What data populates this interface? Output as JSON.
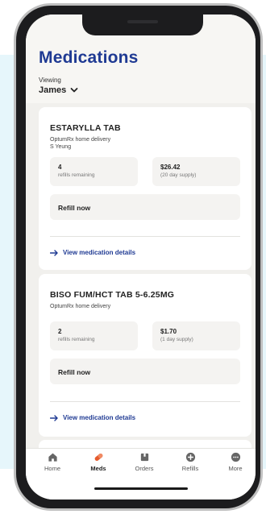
{
  "header": {
    "title": "Medications",
    "viewing_label": "Viewing",
    "viewing_value": "James"
  },
  "medications": [
    {
      "name": "ESTARYLLA TAB",
      "source": "OptumRx home delivery",
      "prescriber": "S Yeung",
      "refills_value": "4",
      "refills_label": "refills remaining",
      "price_value": "$26.42",
      "price_label": "(20 day supply)",
      "refill_button": "Refill now",
      "details_link": "View medication details"
    },
    {
      "name": "BISO FUM/HCT TAB 5-6.25MG",
      "source": "OptumRx home delivery",
      "refills_value": "2",
      "refills_label": "refills remaining",
      "price_value": "$1.70",
      "price_label": "(1 day supply)",
      "refill_button": "Refill now",
      "details_link": "View medication details"
    }
  ],
  "tabs": [
    {
      "label": "Home",
      "icon": "home-icon"
    },
    {
      "label": "Meds",
      "icon": "pill-icon",
      "active": true
    },
    {
      "label": "Orders",
      "icon": "package-icon"
    },
    {
      "label": "Refills",
      "icon": "plus-circle-icon"
    },
    {
      "label": "More",
      "icon": "more-icon"
    }
  ],
  "colors": {
    "brand": "#1f3a93",
    "accent_active": "#e55b2e",
    "background": "#f1f0ed"
  }
}
